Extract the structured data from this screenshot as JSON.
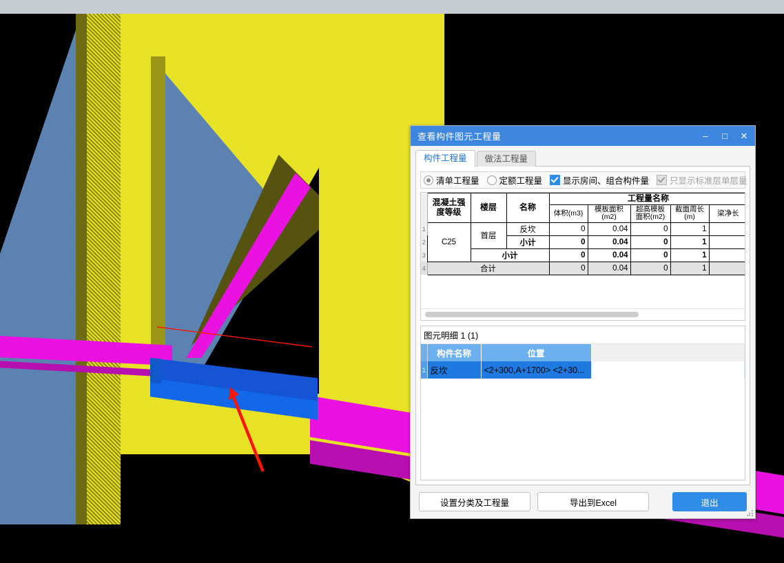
{
  "window": {
    "title": "查看构件图元工程量",
    "controls": [
      {
        "name": "minimize-button",
        "glyph": "–"
      },
      {
        "name": "maximize-button",
        "glyph": "□"
      },
      {
        "name": "close-button",
        "glyph": "✕"
      }
    ]
  },
  "tabs": [
    {
      "label": "构件工程量",
      "active": true
    },
    {
      "label": "做法工程量",
      "active": false
    }
  ],
  "options": {
    "radios": [
      {
        "label": "清单工程量",
        "checked": true
      },
      {
        "label": "定额工程量",
        "checked": false
      }
    ],
    "checkboxes": [
      {
        "label": "显示房间、组合构件量",
        "checked": true,
        "disabled": false
      },
      {
        "label": "只显示标准层单层量",
        "checked": true,
        "disabled": true
      }
    ]
  },
  "quantity_table": {
    "group_header": "工程量名称",
    "columns": [
      "混凝土强度等级",
      "楼层",
      "名称"
    ],
    "measure_columns": [
      "体积(m3)",
      "模板面积(m2)",
      "超高模板面积(m2)",
      "截面周长(m)",
      "梁净长"
    ],
    "rows": [
      {
        "no": "1",
        "grade": "C25",
        "floor": "首层",
        "name": "反坎",
        "values": [
          "0",
          "0.04",
          "0",
          "1",
          ""
        ],
        "bold": false,
        "kind": "data"
      },
      {
        "no": "2",
        "grade": "",
        "floor": "",
        "name": "小计",
        "values": [
          "0",
          "0.04",
          "0",
          "1",
          ""
        ],
        "bold": true,
        "kind": "subtotal-floor"
      },
      {
        "no": "3",
        "grade": "",
        "floor": "",
        "name": "小计",
        "values": [
          "0",
          "0.04",
          "0",
          "1",
          ""
        ],
        "bold": true,
        "kind": "subtotal-grade"
      },
      {
        "no": "4",
        "grade": "",
        "floor": "",
        "name": "合计",
        "values": [
          "0",
          "0.04",
          "0",
          "1",
          ""
        ],
        "bold": false,
        "kind": "total"
      }
    ]
  },
  "detail": {
    "label": "图元明细  1 (1)",
    "columns": [
      "构件名称",
      "位置"
    ],
    "rows": [
      {
        "no": "1",
        "component": "反坎",
        "location": "<2+300,A+1700> <2+30...",
        "selected": true
      }
    ]
  },
  "footer": {
    "settings_label": "设置分类及工程量",
    "export_label": "导出到Excel",
    "exit_label": "退出"
  },
  "viewport": {
    "colors": {
      "top_bar": "#c8cdd4",
      "background": "#000000",
      "wall_yellow": "#e8e226",
      "wall_shadow_olive": "#7e7a15",
      "face_blue_grey": "#5b82b0",
      "beam_magenta": "#e912e0",
      "beam_magenta_dark": "#b70fb0",
      "selected_element_blue": "#1654d6",
      "selected_element_blue_light": "#1268e8",
      "annotation_red": "#ff1500"
    },
    "annotation": "red-arrow-pointing-to-selected-element"
  }
}
